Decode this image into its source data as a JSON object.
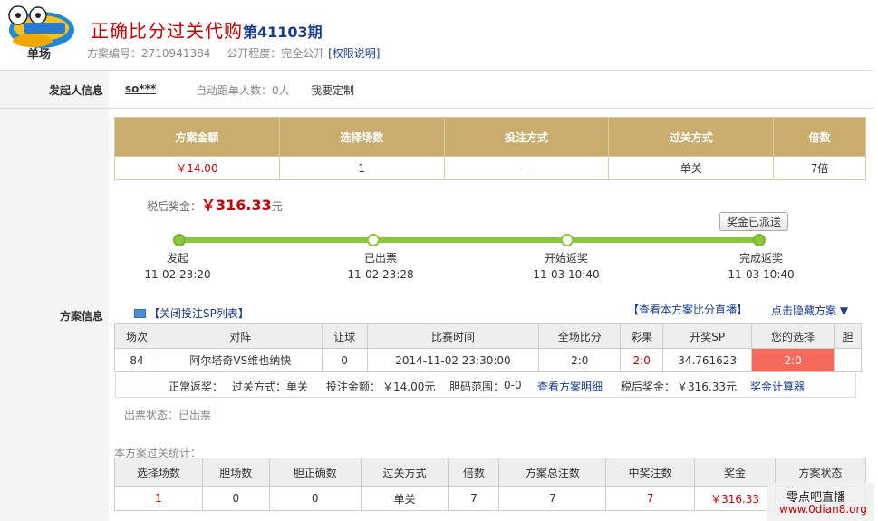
{
  "header": {
    "logo_text": "单场",
    "title": "正确比分过关代购",
    "issue": "第41103期",
    "plan_no_label": "方案编号：",
    "plan_no": "2710941384",
    "openness_label": "公开程度：",
    "openness": "完全公开",
    "perm_link": "[权限说明]"
  },
  "initiator": {
    "label": "发起人信息",
    "name": "so***",
    "follow": "自动跟单人数：0人",
    "custom": "我要定制"
  },
  "plan": {
    "label": "方案信息",
    "summary_headers": [
      "方案金额",
      "选择场数",
      "投注方式",
      "过关方式",
      "倍数"
    ],
    "summary_values": [
      "￥14.00",
      "1",
      "—",
      "单关",
      "7倍"
    ],
    "prize_label": "税后奖金：",
    "prize_amount": "￥316.33",
    "prize_unit": "元",
    "badge": "奖金已派送",
    "steps": [
      {
        "label": "发起",
        "time": "11-02 23:20"
      },
      {
        "label": "已出票",
        "time": "11-02 23:28"
      },
      {
        "label": "开始返奖",
        "time": "11-03 10:40"
      },
      {
        "label": "完成返奖",
        "time": "11-03 10:40"
      }
    ],
    "close_sp_link": "【关闭投注SP列表】",
    "view_live_link": "【查看本方案比分直播】",
    "hide_plan_link": "点击隐藏方案 ▼",
    "match_headers": [
      "场次",
      "对阵",
      "让球",
      "比赛时间",
      "全场比分",
      "彩果",
      "开奖SP",
      "您的选择",
      "胆"
    ],
    "match_row": {
      "no": "84",
      "teams": "阿尔塔奇VS维也纳快",
      "handicap": "0",
      "time": "2014-11-02 23:30:00",
      "score": "2:0",
      "result": "2:0",
      "sp": "34.761623",
      "choice": "2:0",
      "banker": ""
    },
    "return_label": "正常返奖：",
    "pass_label": "过关方式：",
    "pass_value": "单关",
    "bet_amount_label": "投注金额：",
    "bet_amount": "￥14.00元",
    "banker_range_label": "胆码范围：",
    "banker_range": "0-0",
    "detail_link": "查看方案明细",
    "after_tax_label": "税后奖金：",
    "after_tax": "￥316.33元",
    "calc_link": "奖金计算器",
    "ticket_status": "出票状态：已出票",
    "stat_title": "本方案过关统计：",
    "stat_headers": [
      "选择场数",
      "胆场数",
      "胆正确数",
      "过关方式",
      "倍数",
      "方案总注数",
      "中奖注数",
      "奖金",
      "方案状态"
    ],
    "stat_values": [
      "1",
      "0",
      "0",
      "单关",
      "7",
      "7",
      "7",
      "￥316.33",
      ""
    ]
  },
  "watermark": {
    "line1": "零点吧直播",
    "line2": "www.0dian8.org"
  }
}
